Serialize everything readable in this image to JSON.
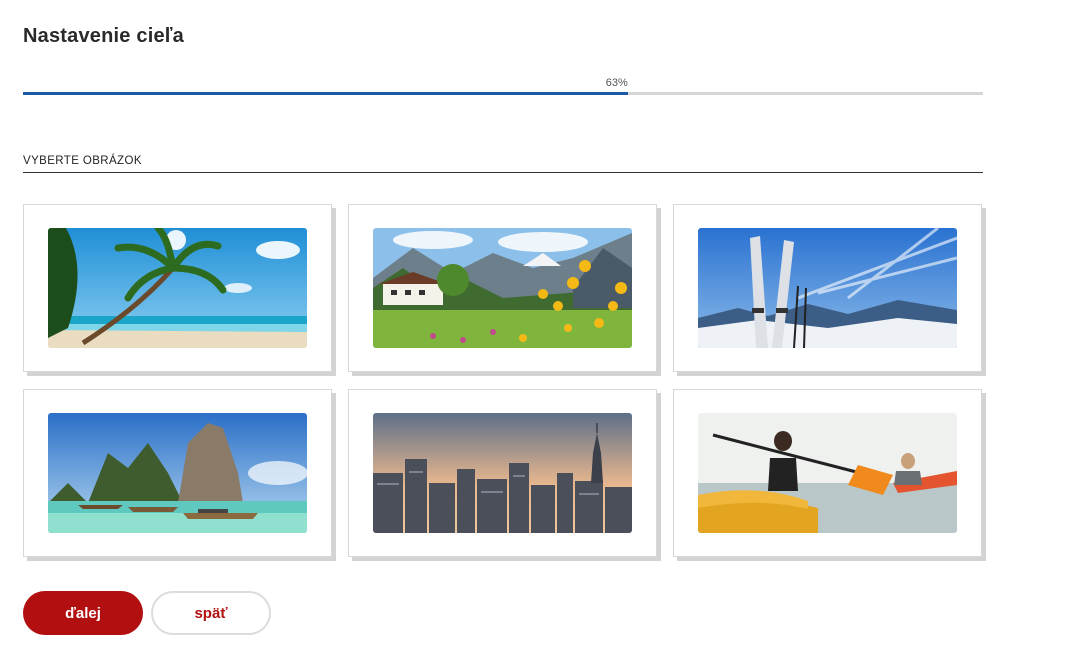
{
  "page": {
    "title": "Nastavenie cieľa"
  },
  "progress": {
    "label": "63%",
    "value": 63
  },
  "section": {
    "label": "VYBERTE OBRÁZOK"
  },
  "images": [
    {
      "id": "beach",
      "name": "image-card-beach"
    },
    {
      "id": "meadow",
      "name": "image-card-meadow"
    },
    {
      "id": "ski",
      "name": "image-card-ski"
    },
    {
      "id": "islands",
      "name": "image-card-islands"
    },
    {
      "id": "city",
      "name": "image-card-city"
    },
    {
      "id": "kayak",
      "name": "image-card-kayak"
    }
  ],
  "buttons": {
    "next_label": "ďalej",
    "back_label": "späť"
  },
  "colors": {
    "accent": "#b20f10",
    "progress": "#1c5aa8"
  }
}
